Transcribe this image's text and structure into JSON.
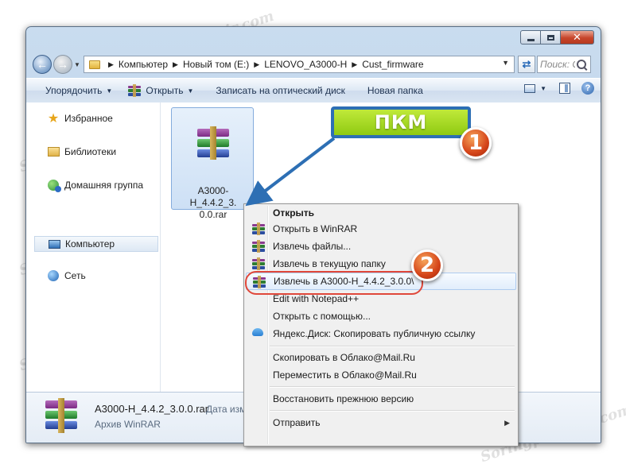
{
  "watermark_text": "Soringpcrepair.com",
  "window": {
    "controls": [
      "minimize-icon",
      "maximize-icon",
      "close-icon"
    ],
    "close_glyph": "✕"
  },
  "address_bar": {
    "crumbs": [
      "Компьютер",
      "Новый том (E:)",
      "LENOVO_A3000-H",
      "Cust_firmware"
    ],
    "search_placeholder": "Поиск: Cust_firmware",
    "search_visible": "Поиск: Cus..."
  },
  "toolbar": {
    "organize_label": "Упорядочить",
    "open_label": "Открыть",
    "burn_label": "Записать на оптический диск",
    "new_folder_label": "Новая папка"
  },
  "nav_pane": {
    "items": [
      {
        "label": "Избранное",
        "icon": "star-icon"
      },
      {
        "label": "Библиотеки",
        "icon": "libraries-icon"
      },
      {
        "label": "Домашняя группа",
        "icon": "homegroup-icon"
      },
      {
        "label": "Компьютер",
        "icon": "computer-icon"
      },
      {
        "label": "Сеть",
        "icon": "network-icon"
      }
    ]
  },
  "file": {
    "name_line1": "A3000-H_4.4.2_3.",
    "name_line2": "0.0.rar"
  },
  "details_pane": {
    "name": "A3000-H_4.4.2_3.0.0.rar",
    "date_label": "Дата изм",
    "type": "Архив WinRAR"
  },
  "context_menu": {
    "items": [
      {
        "label": "Открыть",
        "bold": true
      },
      {
        "label": "Открыть в WinRAR",
        "icon": "winrar-icon"
      },
      {
        "label": "Извлечь файлы...",
        "icon": "winrar-icon"
      },
      {
        "label": "Извлечь в текущую папку",
        "icon": "winrar-icon"
      },
      {
        "label": "Извлечь в A3000-H_4.4.2_3.0.0\\",
        "icon": "winrar-icon",
        "highlighted": true
      },
      {
        "label": "Edit with Notepad++"
      },
      {
        "label": "Открыть с помощью..."
      },
      {
        "label": "Яндекс.Диск: Скопировать публичную ссылку",
        "icon": "yandex-disk-icon"
      },
      {
        "label": "Скопировать в Облако@Mail.Ru"
      },
      {
        "label": "Переместить в Облако@Mail.Ru"
      },
      {
        "label": "Восстановить прежнюю версию"
      },
      {
        "label": "Отправить",
        "submenu": true
      }
    ]
  },
  "annotations": {
    "callout_label": "ПКМ",
    "step1": "1",
    "step2": "2",
    "accent_green": "#a6d91e",
    "accent_blue": "#2d6fb4",
    "badge_orange": "#e05a1e",
    "ring_red": "#e0483a"
  }
}
